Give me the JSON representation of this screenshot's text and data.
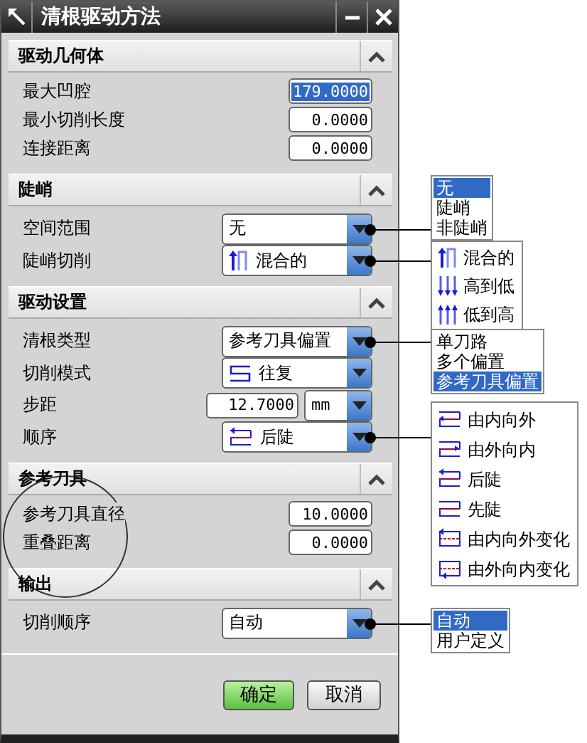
{
  "window": {
    "title": "清根驱动方法"
  },
  "sections": [
    {
      "title": "驱动几何体",
      "expanded": true,
      "rows": [
        {
          "kind": "number",
          "label": "最大凹腔",
          "value": "179.0000",
          "selected": true
        },
        {
          "kind": "number",
          "label": "最小切削长度",
          "value": "0.0000",
          "selected": false
        },
        {
          "kind": "number",
          "label": "连接距离",
          "value": "0.0000",
          "selected": false
        }
      ]
    },
    {
      "title": "陡峭",
      "expanded": true,
      "rows": [
        {
          "kind": "dropdown",
          "label": "空间范围",
          "value": "无",
          "callout": {
            "kind": "plain",
            "options": [
              {
                "label": "无",
                "selected": true
              },
              {
                "label": "陡峭",
                "selected": false
              },
              {
                "label": "非陡峭",
                "selected": false
              }
            ]
          }
        },
        {
          "kind": "icon-dropdown",
          "label": "陡峭切削",
          "value": "混合的",
          "callout": {
            "kind": "steep",
            "options": [
              {
                "label": "混合的",
                "selected": false
              },
              {
                "label": "高到低",
                "selected": false
              },
              {
                "label": "低到高",
                "selected": false
              }
            ]
          }
        }
      ]
    },
    {
      "title": "驱动设置",
      "expanded": true,
      "rows": [
        {
          "kind": "dropdown",
          "label": "清根类型",
          "value": "参考刀具偏置",
          "callout": {
            "kind": "plain",
            "options": [
              {
                "label": "单刀路",
                "selected": false
              },
              {
                "label": "多个偏置",
                "selected": false
              },
              {
                "label": "参考刀具偏置",
                "selected": true
              }
            ]
          }
        },
        {
          "kind": "icon-dropdown",
          "label": "切削模式",
          "value": "往复"
        },
        {
          "kind": "number-unit",
          "label": "步距",
          "value": "12.7000",
          "unit": "mm"
        },
        {
          "kind": "icon-dropdown",
          "label": "顺序",
          "value": "后陡",
          "callout": {
            "kind": "order",
            "options": [
              {
                "label": "由内向外",
                "selected": false
              },
              {
                "label": "由外向内",
                "selected": false
              },
              {
                "label": "后陡",
                "selected": false
              },
              {
                "label": "先陡",
                "selected": false
              },
              {
                "label": "由内向外变化",
                "selected": false
              },
              {
                "label": "由外向内变化",
                "selected": false
              }
            ]
          }
        }
      ]
    },
    {
      "title": "参考刀具",
      "expanded": true,
      "rows": [
        {
          "kind": "number",
          "label": "参考刀具直径",
          "value": "10.0000",
          "selected": false
        },
        {
          "kind": "number",
          "label": "重叠距离",
          "value": "0.0000",
          "selected": false
        }
      ]
    },
    {
      "title": "输出",
      "expanded": true,
      "rows": [
        {
          "kind": "dropdown",
          "label": "切削顺序",
          "value": "自动",
          "callout": {
            "kind": "plain",
            "options": [
              {
                "label": "自动",
                "selected": true
              },
              {
                "label": "用户定义",
                "selected": false
              }
            ]
          }
        }
      ]
    }
  ],
  "buttons": [
    {
      "label": "确定",
      "kind": "default"
    },
    {
      "label": "取消",
      "kind": "normal"
    }
  ]
}
